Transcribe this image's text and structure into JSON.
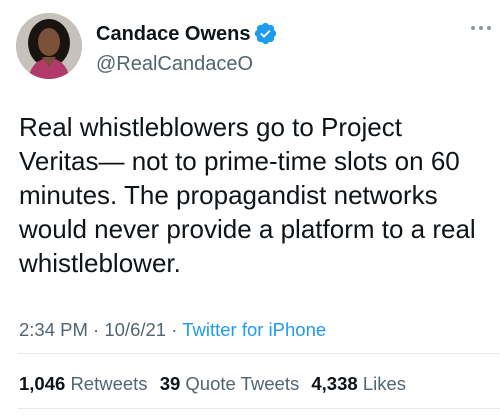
{
  "author": {
    "name": "Candace Owens",
    "handle": "@RealCandaceO",
    "verified": true,
    "avatar_icon": "profile-photo"
  },
  "tweet": {
    "lines": [
      "Real whistleblowers go to Project",
      "Veritas— not to prime-time slots on 60",
      "minutes. The propagandist networks",
      "would never provide a platform to a real",
      "whistleblower."
    ]
  },
  "meta": {
    "time": "2:34 PM",
    "separator": " · ",
    "date": "10/6/21",
    "source": "Twitter for iPhone"
  },
  "stats": {
    "retweets_count": "1,046",
    "retweets_label": "Retweets",
    "quotes_count": "39",
    "quotes_label": "Quote Tweets",
    "likes_count": "4,338",
    "likes_label": "Likes"
  },
  "colors": {
    "text": "#0f1419",
    "secondary": "#536471",
    "link": "#1d9bf0",
    "verified_badge": "#1d9bf0",
    "divider": "#e7e9ea"
  },
  "icons": [
    "verified-badge-icon",
    "more-options-icon"
  ]
}
